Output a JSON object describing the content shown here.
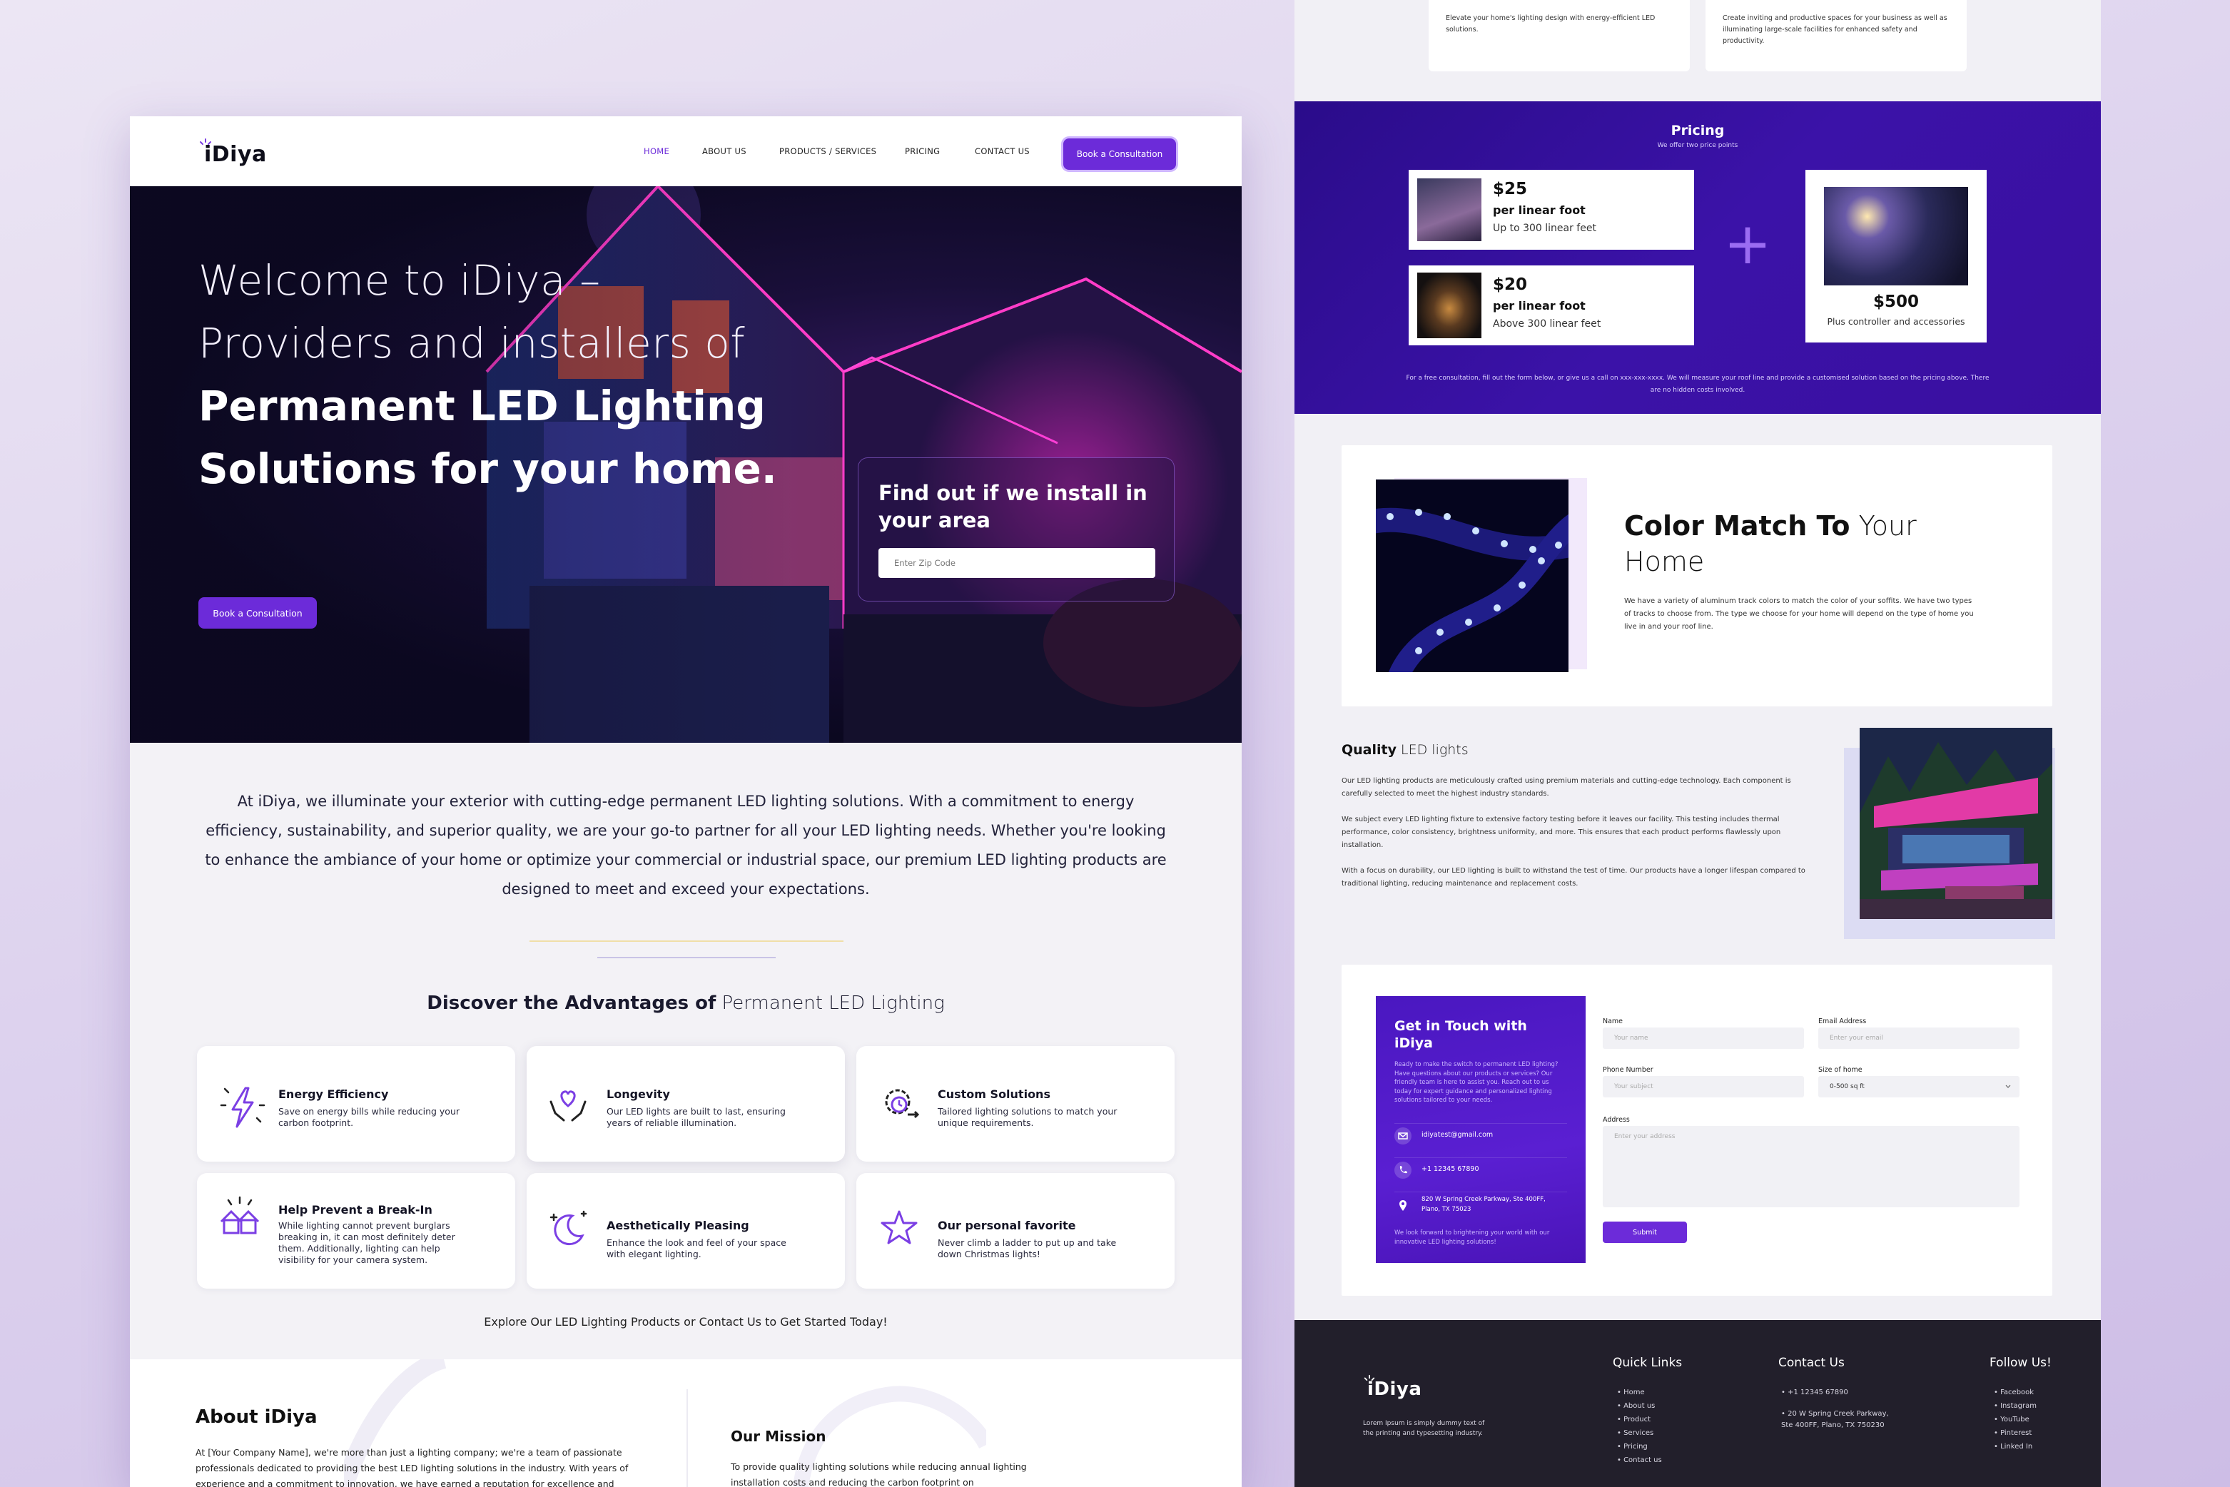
{
  "brand": {
    "name": "iDiya",
    "accent": "#6c2bd9"
  },
  "nav": {
    "items": [
      "HOME",
      "ABOUT US",
      "PRODUCTS / SERVICES",
      "PRICING",
      "CONTACT US"
    ],
    "cta": "Book a Consultation"
  },
  "hero": {
    "line1": "Welcome to iDiya –",
    "line2": "Providers and installers of",
    "line3": "Permanent LED Lighting",
    "line4": "Solutions for your home.",
    "cta": "Book a Consultation",
    "zip_title": "Find out if we install in your area",
    "zip_placeholder": "Enter Zip Code"
  },
  "intro": "At iDiya, we illuminate your exterior with cutting-edge permanent LED lighting solutions. With a commitment to energy efficiency, sustainability, and superior quality, we are your go-to partner for all your LED lighting needs. Whether you're looking to enhance the ambiance of your home or optimize your commercial or industrial space, our premium LED lighting products are designed to meet and exceed your expectations.",
  "advantages": {
    "title_bold": "Discover the Advantages of",
    "title_light": "Permanent LED Lighting",
    "cards": [
      {
        "icon": "lightning-icon",
        "title": "Energy Efficiency",
        "desc": "Save on energy bills while reducing your carbon footprint."
      },
      {
        "icon": "heart-hands-icon",
        "title": "Longevity",
        "desc": "Our LED lights are built to last, ensuring years of reliable illumination."
      },
      {
        "icon": "gear-clock-icon",
        "title": "Custom Solutions",
        "desc": "Tailored lighting solutions to match your unique requirements."
      },
      {
        "icon": "house-alert-icon",
        "title": "Help Prevent a Break-In",
        "desc": "While lighting cannot prevent burglars breaking in, it can most definitely deter them. Additionally, lighting can help visibility for your camera system."
      },
      {
        "icon": "moon-stars-icon",
        "title": "Aesthetically Pleasing",
        "desc": "Enhance the look and feel of your space with elegant lighting."
      },
      {
        "icon": "star-icon",
        "title": "Our personal favorite",
        "desc": "Never climb a ladder to put up and take down Christmas lights!"
      }
    ],
    "explore": "Explore Our LED Lighting Products or Contact Us to Get Started Today!"
  },
  "about": {
    "title": "About iDiya",
    "text": "At [Your Company Name], we're more than just a lighting company; we're a team of passionate professionals dedicated to providing the best LED lighting solutions in the industry. With years of experience and a commitment to innovation, we have earned a reputation for excellence and",
    "mission_title": "Our Mission",
    "mission_text": "To provide quality lighting solutions while reducing annual lighting installation costs and  reducing the carbon footprint on"
  },
  "top_cards": [
    {
      "text": "Elevate your home's lighting design with energy-efficient LED solutions."
    },
    {
      "text": "Create inviting and productive spaces for your business as well as illuminating large-scale facilities for enhanced safety and productivity."
    }
  ],
  "pricing": {
    "title": "Pricing",
    "subtitle": "We offer two price points",
    "tiers": [
      {
        "price": "$25",
        "unit": "per linear foot",
        "note": "Up to 300 linear feet"
      },
      {
        "price": "$20",
        "unit": "per linear foot",
        "note": "Above 300 linear feet"
      }
    ],
    "plus": "+",
    "addon_price": "$500",
    "addon_note": "Plus controller and accessories",
    "footnote": "For a free consultation, fill out the form below, or give us a call on xxx-xxx-xxxx. We will measure your roof line and provide a customised solution based on the pricing above. There are no hidden costs involved."
  },
  "color_match": {
    "title_bold": "Color Match To",
    "title_light1": "Your",
    "title_light2": "Home",
    "text": "We have a variety of aluminum track colors to match the color of your soffits. We have two types of tracks to choose from. The type we choose for your home will depend on the type of home you live in and your roof line."
  },
  "quality": {
    "title_bold": "Quality",
    "title_light": "LED lights",
    "p1": "Our LED lighting products are meticulously crafted using premium materials and cutting-edge technology. Each component is carefully selected to meet the highest industry standards.",
    "p2": "We subject every LED lighting fixture to extensive factory testing before it leaves our facility. This testing includes thermal performance, color consistency, brightness uniformity, and more. This ensures that each product performs flawlessly upon installation.",
    "p3": "With a focus on durability, our LED lighting is built to withstand the test of time. Our products have a longer lifespan compared to traditional lighting, reducing maintenance and replacement costs."
  },
  "contact": {
    "title": "Get in Touch with iDiya",
    "intro": "Ready to make the switch to permanent LED lighting? Have questions about our products or services? Our friendly team is here to assist you. Reach out to us today for expert guidance and personalized lighting solutions tailored to your needs.",
    "email": "idiyatest@gmail.com",
    "phone": "+1 12345 67890",
    "address": "820 W Spring Creek Parkway, Ste 400FF, Plano, TX 75023",
    "outro": "We look forward to brightening your world with our innovative LED lighting solutions!",
    "form": {
      "name_label": "Name",
      "name_ph": "Your name",
      "email_label": "Email Address",
      "email_ph": "Enter your email",
      "phone_label": "Phone Number",
      "phone_ph": "Your subject",
      "size_label": "Size of home",
      "size_value": "0-500 sq ft",
      "address_label": "Address",
      "address_ph": "Enter your address",
      "submit": "Submit"
    }
  },
  "footer": {
    "tagline": "Lorem Ipsum is simply dummy text of the printing and typesetting industry.",
    "quick_title": "Quick Links",
    "quick": [
      "Home",
      "About us",
      "Product",
      "Services",
      "Pricing",
      "Contact us"
    ],
    "contact_title": "Contact Us",
    "contact_phone": "+1 12345 67890",
    "contact_address": "20 W Spring Creek Parkway, Ste 400FF, Plano, TX 750230",
    "follow_title": "Follow Us!",
    "follow": [
      "Facebook",
      "Instagram",
      "YouTube",
      "Pinterest",
      "Linked In"
    ]
  }
}
